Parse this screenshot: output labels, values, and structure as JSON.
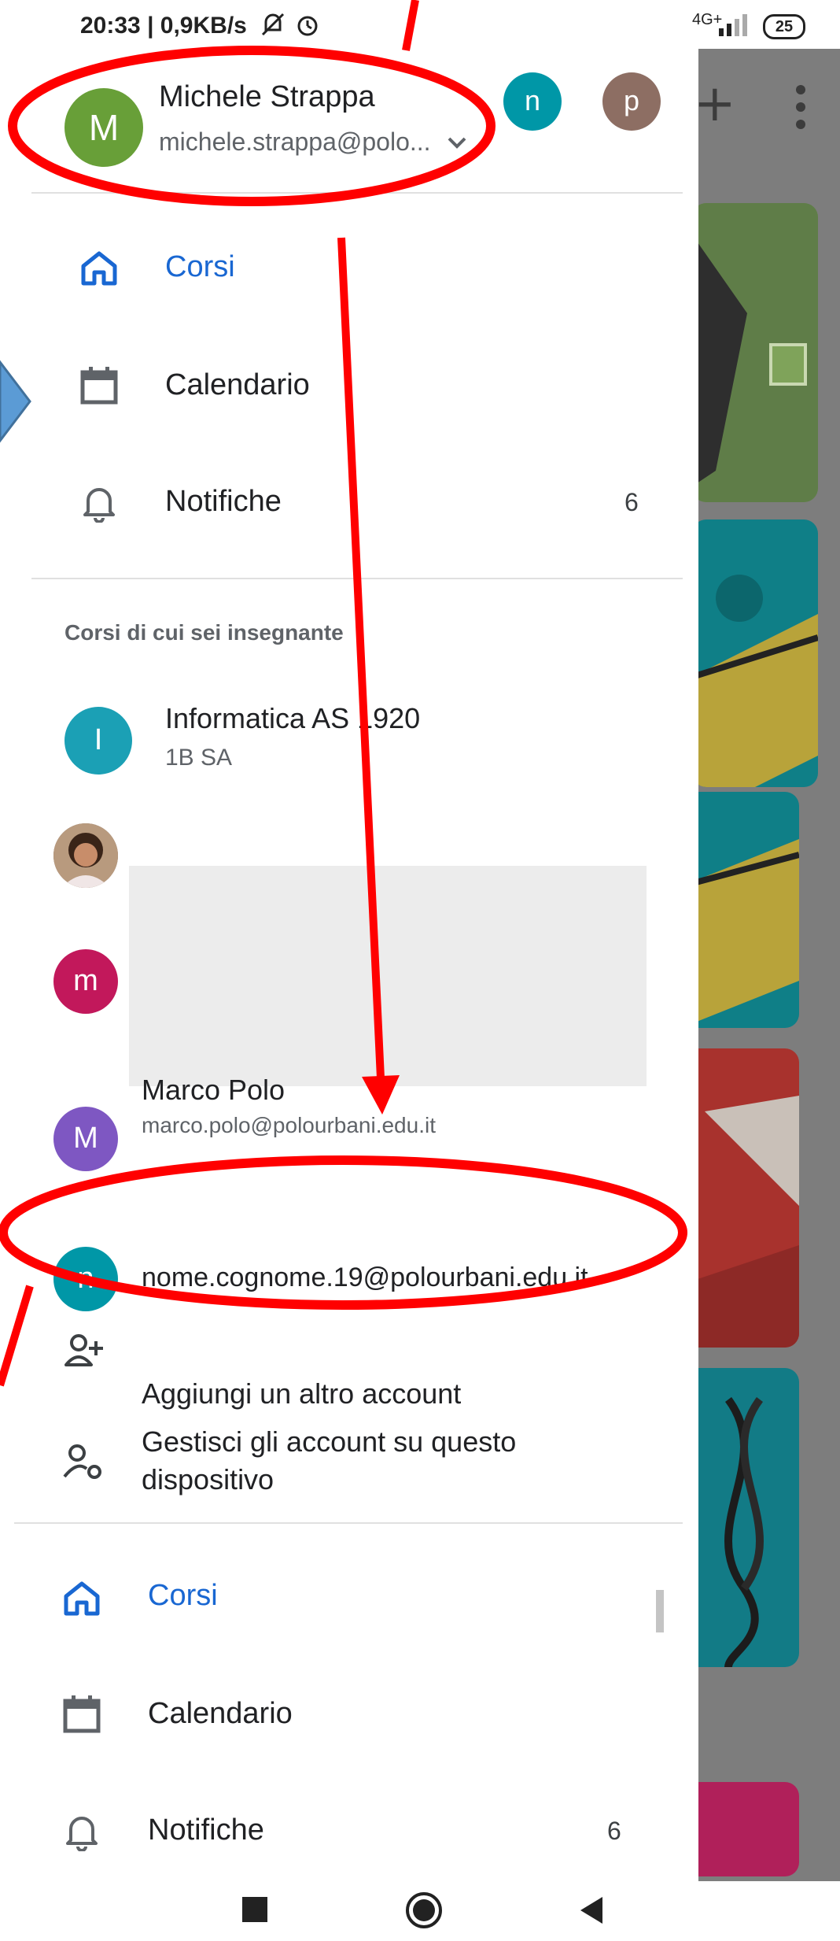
{
  "status_bar": {
    "time": "20:33 | 0,9KB/s",
    "network": "4G+",
    "battery": "25"
  },
  "account": {
    "name": "Michele Strappa",
    "email": "michele.strappa@polo...",
    "avatar_letter": "M",
    "other_avatars": [
      "n",
      "p"
    ]
  },
  "nav_top": [
    {
      "label": "Corsi",
      "icon": "home-icon",
      "active": true
    },
    {
      "label": "Calendario",
      "icon": "calendar-icon",
      "active": false
    },
    {
      "label": "Notifiche",
      "icon": "bell-icon",
      "count": "6"
    }
  ],
  "teaching_section": {
    "title": "Corsi di cui sei insegnante",
    "courses": [
      {
        "avatar": "I",
        "name": "Informatica AS 1920",
        "sub": "1B SA"
      }
    ]
  },
  "accounts_list": [
    {
      "avatar": "photo",
      "name": "",
      "email": ""
    },
    {
      "avatar": "m",
      "name": "",
      "email": ""
    },
    {
      "avatar": "M",
      "name": "Marco Polo",
      "email": "marco.polo@polourbani.edu.it"
    },
    {
      "avatar": "n",
      "name": "",
      "email": "nome.cognome.19@polourbani.edu.it"
    }
  ],
  "account_actions": {
    "add": "Aggiungi un altro account",
    "manage": "Gestisci gli account su questo dispositivo"
  },
  "nav_bottom": [
    {
      "label": "Corsi",
      "icon": "home-icon",
      "active": true
    },
    {
      "label": "Calendario",
      "icon": "calendar-icon",
      "active": false
    },
    {
      "label": "Notifiche",
      "icon": "bell-icon",
      "count": "6"
    }
  ],
  "colors": {
    "accent": "#1967d2",
    "avatar_green": "#689f38",
    "avatar_teal": "#0097a7",
    "avatar_brown": "#8d6e63",
    "avatar_magenta": "#c2185b",
    "avatar_purple": "#7e57c2",
    "annotation_red": "#ff0000"
  }
}
